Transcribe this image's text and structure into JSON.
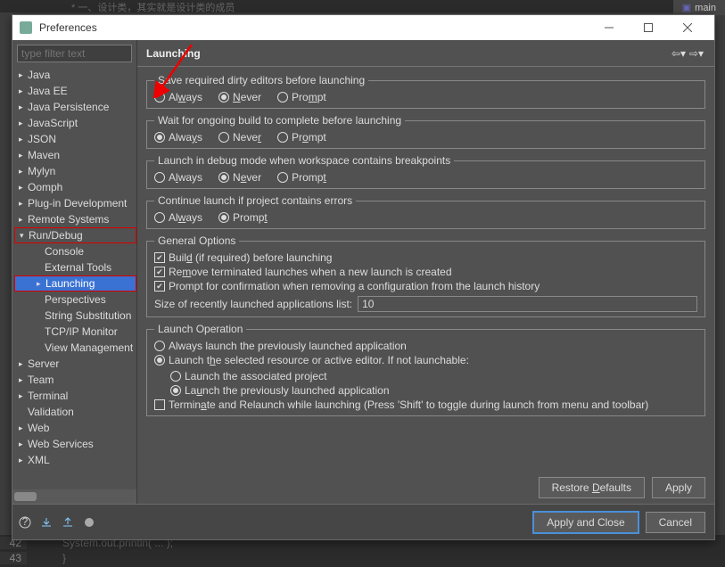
{
  "bg": {
    "tab": "main",
    "topline": "*  一、设计类，其实就是设计类的成员",
    "bottom": [
      {
        "n": "42",
        "code": "System.out.println( ... );"
      },
      {
        "n": "43",
        "code": "}"
      }
    ]
  },
  "dialog": {
    "title": "Preferences",
    "filter_placeholder": "type filter text",
    "tree": [
      {
        "label": "Java",
        "level": 0,
        "twisty": "▸"
      },
      {
        "label": "Java EE",
        "level": 0,
        "twisty": "▸"
      },
      {
        "label": "Java Persistence",
        "level": 0,
        "twisty": "▸"
      },
      {
        "label": "JavaScript",
        "level": 0,
        "twisty": "▸"
      },
      {
        "label": "JSON",
        "level": 0,
        "twisty": "▸"
      },
      {
        "label": "Maven",
        "level": 0,
        "twisty": "▸"
      },
      {
        "label": "Mylyn",
        "level": 0,
        "twisty": "▸"
      },
      {
        "label": "Oomph",
        "level": 0,
        "twisty": "▸"
      },
      {
        "label": "Plug-in Development",
        "level": 0,
        "twisty": "▸"
      },
      {
        "label": "Remote Systems",
        "level": 0,
        "twisty": "▸"
      },
      {
        "label": "Run/Debug",
        "level": 0,
        "twisty": "▾",
        "red": true
      },
      {
        "label": "Console",
        "level": 1
      },
      {
        "label": "External Tools",
        "level": 1
      },
      {
        "label": "Launching",
        "level": 1,
        "twisty": "▸",
        "selected": true,
        "red": true
      },
      {
        "label": "Perspectives",
        "level": 1
      },
      {
        "label": "String Substitution",
        "level": 1
      },
      {
        "label": "TCP/IP Monitor",
        "level": 1
      },
      {
        "label": "View Management",
        "level": 1
      },
      {
        "label": "Server",
        "level": 0,
        "twisty": "▸"
      },
      {
        "label": "Team",
        "level": 0,
        "twisty": "▸"
      },
      {
        "label": "Terminal",
        "level": 0,
        "twisty": "▸"
      },
      {
        "label": "Validation",
        "level": 0
      },
      {
        "label": "Web",
        "level": 0,
        "twisty": "▸"
      },
      {
        "label": "Web Services",
        "level": 0,
        "twisty": "▸"
      },
      {
        "label": "XML",
        "level": 0,
        "twisty": "▸"
      }
    ],
    "header": "Launching",
    "groups": {
      "save": {
        "legend": "Save required dirty editors before launching",
        "options": [
          "Always",
          "Never",
          "Prompt"
        ],
        "selected": 1
      },
      "wait": {
        "legend": "Wait for ongoing build to complete before launching",
        "options": [
          "Always",
          "Never",
          "Prompt"
        ],
        "selected": 0
      },
      "debug": {
        "legend": "Launch in debug mode when workspace contains breakpoints",
        "options": [
          "Always",
          "Never",
          "Prompt"
        ],
        "selected": 1
      },
      "errors": {
        "legend": "Continue launch if project contains errors",
        "options": [
          "Always",
          "Prompt"
        ],
        "selected": 1
      },
      "general": {
        "legend": "General Options",
        "checks": [
          {
            "label": "Build (if required) before launching",
            "checked": true
          },
          {
            "label": "Remove terminated launches when a new launch is created",
            "checked": true
          },
          {
            "label": "Prompt for confirmation when removing a configuration from the launch history",
            "checked": true
          }
        ],
        "size_label": "Size of recently launched applications list:",
        "size_value": "10"
      },
      "operation": {
        "legend": "Launch Operation",
        "opt1": "Always launch the previously launched application",
        "opt2": "Launch the selected resource or active editor. If not launchable:",
        "sub1": "Launch the associated project",
        "sub2": "Launch the previously launched application",
        "terminate": "Terminate and Relaunch while launching (Press 'Shift' to toggle during launch from menu and toolbar)"
      }
    },
    "buttons": {
      "restore": "Restore Defaults",
      "apply": "Apply",
      "apply_close": "Apply and Close",
      "cancel": "Cancel"
    }
  }
}
